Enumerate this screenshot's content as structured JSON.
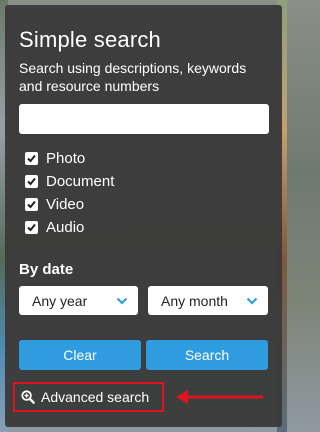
{
  "panel": {
    "title": "Simple search",
    "subtitle": "Search using descriptions, keywords and resource numbers"
  },
  "search": {
    "value": "",
    "placeholder": ""
  },
  "types": [
    {
      "label": "Photo",
      "checked": true
    },
    {
      "label": "Document",
      "checked": true
    },
    {
      "label": "Video",
      "checked": true
    },
    {
      "label": "Audio",
      "checked": true
    }
  ],
  "by_date": {
    "label": "By date",
    "year": "Any year",
    "month": "Any month"
  },
  "buttons": {
    "clear": "Clear",
    "search": "Search"
  },
  "advanced": {
    "label": "Advanced search"
  },
  "colors": {
    "accent": "#2f9ce0",
    "highlight": "#e0141e",
    "panel": "#3a3a3a"
  },
  "icons": [
    "check-icon",
    "chevron-down-icon",
    "zoom-in-icon",
    "arrow-left-icon"
  ]
}
